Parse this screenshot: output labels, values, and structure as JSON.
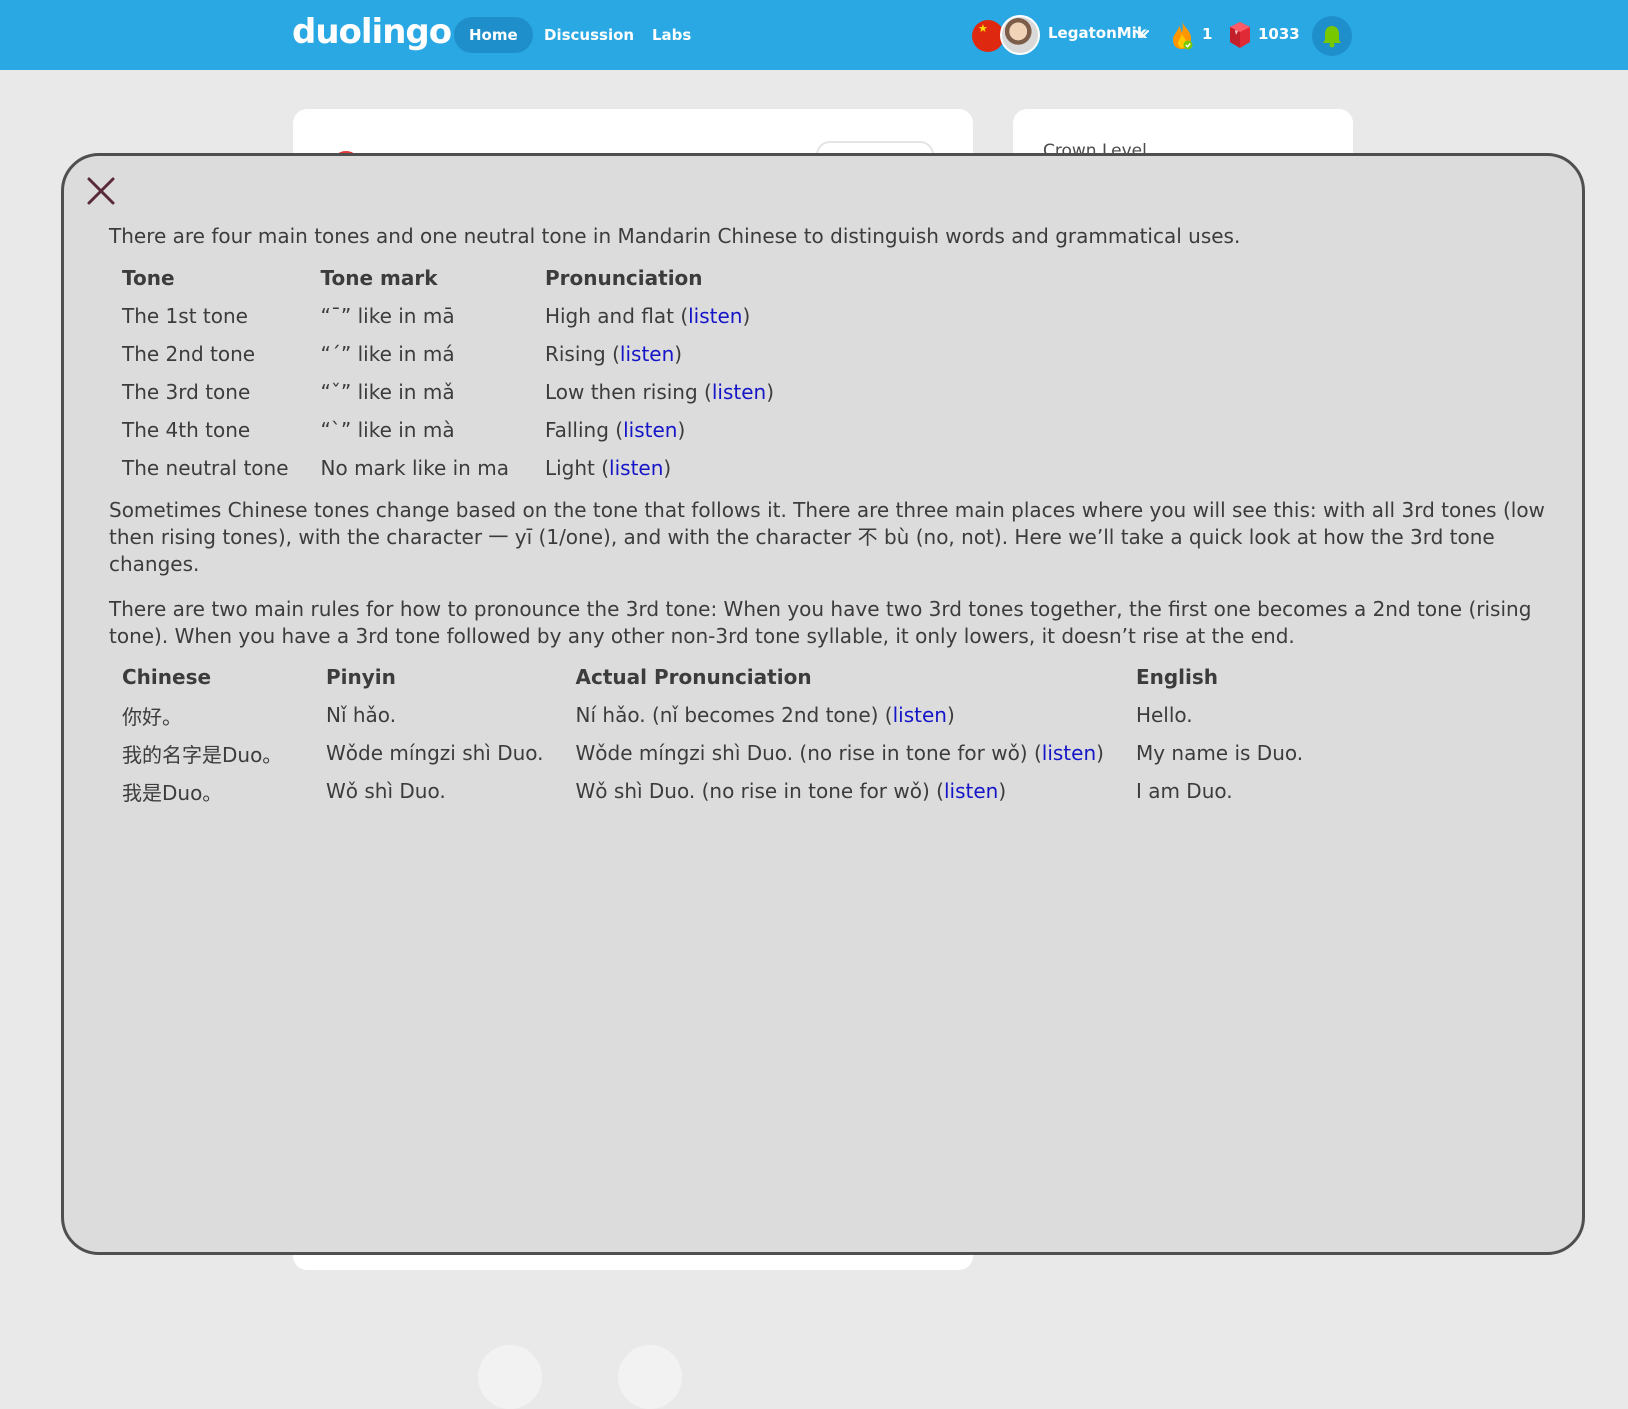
{
  "topbar": {
    "logo": "duolingo",
    "nav": [
      "Home",
      "Discussion",
      "Labs"
    ],
    "username": "LegatonMik",
    "streak": "1",
    "gems": "1033"
  },
  "background": {
    "crown_level": "Crown Level"
  },
  "modal": {
    "intro": "There are four main tones and one neutral tone in Mandarin Chinese to distinguish words and grammatical uses.",
    "tones_headers": [
      "Tone",
      "Tone mark",
      "Pronunciation"
    ],
    "tones": [
      {
        "tone": "The 1st tone",
        "mark": "“ˉ” like in mā",
        "pron": "High and flat (",
        "listen": "listen",
        "close": ")"
      },
      {
        "tone": "The 2nd tone",
        "mark": "“ˊ” like in má",
        "pron": "Rising (",
        "listen": "listen",
        "close": ")"
      },
      {
        "tone": "The 3rd tone",
        "mark": "“ˇ” like in mǎ",
        "pron": "Low then rising (",
        "listen": "listen",
        "close": ")"
      },
      {
        "tone": "The 4th tone",
        "mark": "“ˋ” like in mà",
        "pron": "Falling (",
        "listen": "listen",
        "close": ")"
      },
      {
        "tone": "The neutral tone",
        "mark": "No mark like in ma",
        "pron": "Light (",
        "listen": "listen",
        "close": ")"
      }
    ],
    "para2": "Sometimes Chinese tones change based on the tone that follows it. There are three main places where you will see this: with all 3rd tones (low then rising tones), with the character 一 yī (1/one), and with the character 不 bù (no, not). Here we’ll take a quick look at how the 3rd tone changes.",
    "para3": "There are two main rules for how to pronounce the 3rd tone: When you have two 3rd tones together, the first one becomes a 2nd tone (rising tone). When you have a 3rd tone followed by any other non-3rd tone syllable, it only lowers, it doesn’t rise at the end.",
    "examples_headers": [
      "Chinese",
      "Pinyin",
      "Actual Pronunciation",
      "English"
    ],
    "examples": [
      {
        "chinese": "你好。",
        "pinyin": "Nǐ hǎo.",
        "actual": "Ní hǎo. (nǐ becomes 2nd tone) (",
        "listen": "listen",
        "close": ")",
        "english": "Hello."
      },
      {
        "chinese": "我的名字是Duo。",
        "pinyin": "Wǒde míngzi shì Duo.",
        "actual": "Wǒde míngzi shì Duo. (no rise in tone for wǒ) (",
        "listen": "listen",
        "close": ")",
        "english": "My name is Duo."
      },
      {
        "chinese": "我是Duo。",
        "pinyin": "Wǒ shì Duo.",
        "actual": "Wǒ shì Duo. (no rise in tone for wǒ) (",
        "listen": "listen",
        "close": ")",
        "english": "I am Duo."
      }
    ]
  },
  "colors": {
    "topbar": "#2aa8e4",
    "modal_bg": "#dcdcdc",
    "link": "#1515c8",
    "close_x": "#5a2a3a"
  },
  "icons": [
    "close-icon",
    "china-flag-icon",
    "chevron-down-icon",
    "streak-flame-icon",
    "gem-icon",
    "bell-icon"
  ]
}
